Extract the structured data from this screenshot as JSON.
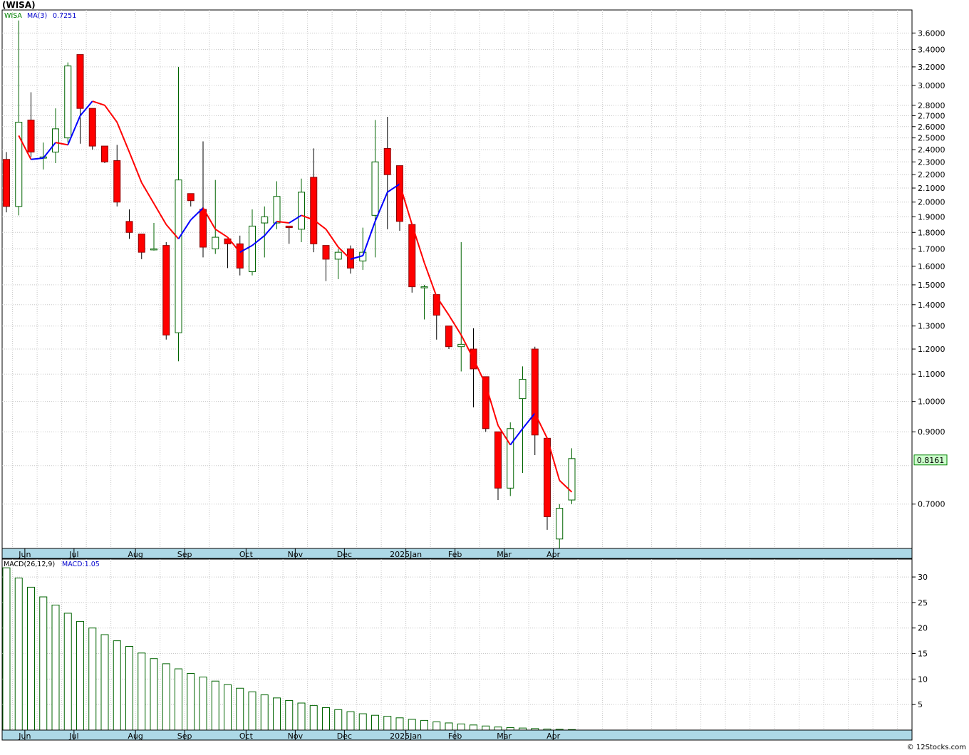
{
  "title": "(WISA)",
  "legend": {
    "ticker": "WISA",
    "ma_label": "MA(3)",
    "ma_value": "0.7251",
    "macd_label": "MACD(26,12,9)",
    "macd_value": "MACD:1.05"
  },
  "last_price_label": "0.8161",
  "footer": "© 12Stocks.com",
  "colors": {
    "up_fill": "#ffffff",
    "up_stroke": "#006400",
    "down_fill": "#ff0000",
    "down_stroke": "#8b0000",
    "ma_up": "#0000ff",
    "ma_down": "#ff0000",
    "axis_band": "#add8e6",
    "price_box": "#ccffcc",
    "grid": "#c8c8c8"
  },
  "chart_data": [
    {
      "type": "candlestick",
      "scale": "log",
      "ylim": [
        0.6,
        3.9
      ],
      "x_labels": [
        "Jun",
        "Jul",
        "Aug",
        "Sep",
        "Oct",
        "Nov",
        "Dec",
        "2025Jan",
        "Feb",
        "Mar",
        "Apr"
      ],
      "y_ticks": [
        "3.6000",
        "3.4000",
        "3.2000",
        "3.0000",
        "2.8000",
        "2.7000",
        "2.6000",
        "2.5000",
        "2.4000",
        "2.3000",
        "2.2000",
        "2.1000",
        "2.0000",
        "1.9000",
        "1.8000",
        "1.7000",
        "1.6000",
        "1.5000",
        "1.4000",
        "1.3000",
        "1.2000",
        "1.1000",
        "1.0000",
        "0.9000",
        "0.7000"
      ],
      "candles": [
        {
          "o": 2.32,
          "h": 2.38,
          "l": 1.93,
          "c": 1.97
        },
        {
          "o": 1.97,
          "h": 3.76,
          "l": 1.91,
          "c": 2.64
        },
        {
          "o": 2.66,
          "h": 2.93,
          "l": 2.34,
          "c": 2.38
        },
        {
          "o": 2.33,
          "h": 2.46,
          "l": 2.24,
          "c": 2.34
        },
        {
          "o": 2.38,
          "h": 2.77,
          "l": 2.29,
          "c": 2.58
        },
        {
          "o": 2.5,
          "h": 3.25,
          "l": 2.46,
          "c": 3.21
        },
        {
          "o": 3.34,
          "h": 3.34,
          "l": 2.45,
          "c": 2.77
        },
        {
          "o": 2.77,
          "h": 2.77,
          "l": 2.4,
          "c": 2.43
        },
        {
          "o": 2.43,
          "h": 2.43,
          "l": 2.29,
          "c": 2.3
        },
        {
          "o": 2.31,
          "h": 2.44,
          "l": 1.97,
          "c": 2.0
        },
        {
          "o": 1.87,
          "h": 1.95,
          "l": 1.76,
          "c": 1.8
        },
        {
          "o": 1.79,
          "h": 1.79,
          "l": 1.64,
          "c": 1.68
        },
        {
          "o": 1.7,
          "h": 1.86,
          "l": 1.69,
          "c": 1.7
        },
        {
          "o": 1.72,
          "h": 1.74,
          "l": 1.24,
          "c": 1.26
        },
        {
          "o": 1.27,
          "h": 3.2,
          "l": 1.15,
          "c": 2.16
        },
        {
          "o": 2.06,
          "h": 2.06,
          "l": 1.97,
          "c": 2.01
        },
        {
          "o": 1.95,
          "h": 2.47,
          "l": 1.65,
          "c": 1.71
        },
        {
          "o": 1.7,
          "h": 2.16,
          "l": 1.67,
          "c": 1.77
        },
        {
          "o": 1.76,
          "h": 1.76,
          "l": 1.59,
          "c": 1.73
        },
        {
          "o": 1.73,
          "h": 1.78,
          "l": 1.55,
          "c": 1.59
        },
        {
          "o": 1.57,
          "h": 1.95,
          "l": 1.55,
          "c": 1.84
        },
        {
          "o": 1.86,
          "h": 1.97,
          "l": 1.65,
          "c": 1.9
        },
        {
          "o": 1.86,
          "h": 2.15,
          "l": 1.82,
          "c": 2.04
        },
        {
          "o": 1.84,
          "h": 1.84,
          "l": 1.73,
          "c": 1.83
        },
        {
          "o": 1.82,
          "h": 2.17,
          "l": 1.74,
          "c": 2.07
        },
        {
          "o": 2.18,
          "h": 2.41,
          "l": 1.68,
          "c": 1.73
        },
        {
          "o": 1.72,
          "h": 1.72,
          "l": 1.52,
          "c": 1.64
        },
        {
          "o": 1.64,
          "h": 1.7,
          "l": 1.53,
          "c": 1.68
        },
        {
          "o": 1.7,
          "h": 1.72,
          "l": 1.56,
          "c": 1.59
        },
        {
          "o": 1.63,
          "h": 1.83,
          "l": 1.58,
          "c": 1.68
        },
        {
          "o": 1.91,
          "h": 2.66,
          "l": 1.65,
          "c": 2.3
        },
        {
          "o": 2.41,
          "h": 2.69,
          "l": 1.82,
          "c": 2.2
        },
        {
          "o": 2.27,
          "h": 2.27,
          "l": 1.81,
          "c": 1.87
        },
        {
          "o": 1.85,
          "h": 1.85,
          "l": 1.46,
          "c": 1.49
        },
        {
          "o": 1.49,
          "h": 1.5,
          "l": 1.33,
          "c": 1.49
        },
        {
          "o": 1.45,
          "h": 1.45,
          "l": 1.24,
          "c": 1.35
        },
        {
          "o": 1.3,
          "h": 1.3,
          "l": 1.2,
          "c": 1.21
        },
        {
          "o": 1.21,
          "h": 1.74,
          "l": 1.11,
          "c": 1.22
        },
        {
          "o": 1.2,
          "h": 1.29,
          "l": 0.98,
          "c": 1.12
        },
        {
          "o": 1.09,
          "h": 1.09,
          "l": 0.9,
          "c": 0.91
        },
        {
          "o": 0.9,
          "h": 0.9,
          "l": 0.71,
          "c": 0.74
        },
        {
          "o": 0.74,
          "h": 0.93,
          "l": 0.72,
          "c": 0.91
        },
        {
          "o": 1.01,
          "h": 1.13,
          "l": 0.78,
          "c": 1.08
        },
        {
          "o": 1.2,
          "h": 1.21,
          "l": 0.83,
          "c": 0.89
        },
        {
          "o": 0.88,
          "h": 0.88,
          "l": 0.64,
          "c": 0.67
        },
        {
          "o": 0.62,
          "h": 0.7,
          "l": 0.6,
          "c": 0.69
        },
        {
          "o": 0.71,
          "h": 0.85,
          "l": 0.7,
          "c": 0.82
        }
      ],
      "ma": [
        null,
        2.52,
        2.32,
        2.33,
        2.46,
        2.44,
        2.7,
        2.84,
        2.8,
        2.64,
        2.38,
        2.14,
        1.99,
        1.85,
        1.76,
        1.88,
        1.96,
        1.82,
        1.77,
        1.68,
        1.72,
        1.78,
        1.87,
        1.86,
        1.91,
        1.88,
        1.82,
        1.71,
        1.64,
        1.66,
        1.87,
        2.07,
        2.13,
        1.85,
        1.62,
        1.44,
        1.35,
        1.26,
        1.16,
        1.06,
        0.92,
        0.86,
        0.91,
        0.96,
        0.88,
        0.76,
        0.73
      ],
      "last_price": 0.8161
    },
    {
      "type": "bar",
      "title": "MACD(26,12,9)",
      "ylim": [
        0,
        33.5
      ],
      "y_ticks": [
        30,
        25,
        20,
        15,
        10,
        5
      ],
      "values": [
        31.8,
        29.8,
        28.0,
        26.1,
        24.5,
        22.9,
        21.3,
        20.0,
        18.7,
        17.5,
        16.4,
        15.1,
        14.0,
        13.0,
        12.0,
        11.1,
        10.4,
        9.6,
        8.9,
        8.2,
        7.5,
        6.9,
        6.3,
        5.8,
        5.3,
        4.8,
        4.4,
        4.0,
        3.6,
        3.2,
        2.9,
        2.7,
        2.4,
        2.1,
        1.9,
        1.6,
        1.4,
        1.2,
        1.0,
        0.8,
        0.6,
        0.5,
        0.4,
        0.3,
        0.2,
        0.15,
        0.1
      ]
    }
  ]
}
